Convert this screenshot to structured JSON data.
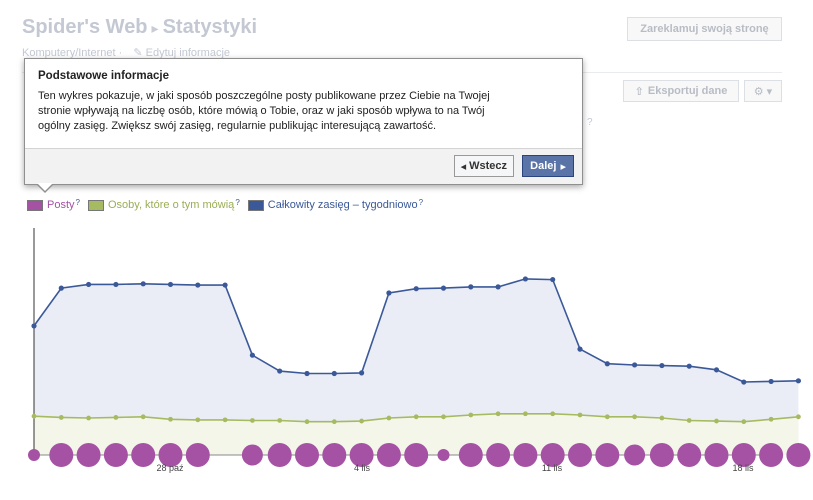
{
  "header": {
    "title": "Spider's Web",
    "title_sep": "▸",
    "section": "Statystyki",
    "category": "Komputery/Internet",
    "category_sep": "·",
    "edit_label": "Edytuj informacje",
    "promote_label": "Zareklamuj swoją stronę"
  },
  "toolbar": {
    "export_label": "Eksportuj dane",
    "faded_q": "?"
  },
  "popup": {
    "title": "Podstawowe informacje",
    "text_line1": "Ten wykres pokazuje, w jaki sposób poszczególne posty publikowane przez Ciebie na Twojej",
    "text_line2": "stronie wpływają na liczbę osób, które mówią o Tobie, oraz w jaki sposób wpływa to na Twój",
    "text_line3": "ogólny zasięg. Zwiększ swój zasięg, regularnie publikując interesującą zawartość.",
    "back_label": "Wstecz",
    "next_label": "Dalej"
  },
  "legend": [
    {
      "label": "Posty",
      "q": "?",
      "color": "#a552a4"
    },
    {
      "label": "Osoby, które o tym mówią",
      "q": "?",
      "color": "#a6bb61"
    },
    {
      "label": "Całkowity zasięg – tygodniowo",
      "q": "?",
      "color": "#3b5998"
    }
  ],
  "colors": {
    "reach_line": "#3b5998",
    "reach_fill": "#eaedf6",
    "talking_line": "#a6bb61",
    "talking_fill": "#f4f6ea",
    "posts": "#a552a4"
  },
  "chart_data": {
    "type": "line",
    "x_ticks": [
      "28 paź",
      "4 lis",
      "11 lis",
      "18 lis"
    ],
    "series": [
      {
        "name": "Całkowity zasięg – tygodniowo",
        "values": [
          64,
          95,
          98,
          98,
          98.5,
          98,
          97.5,
          97.5,
          40,
          27,
          25,
          25,
          25.5,
          91,
          94.5,
          95,
          96,
          96,
          102.5,
          102,
          45,
          33,
          32,
          31.5,
          31,
          28,
          18,
          18.5,
          19
        ]
      },
      {
        "name": "Posty",
        "values": [
          1,
          3,
          3,
          3,
          3,
          3,
          3,
          0,
          2,
          3,
          3,
          3,
          3,
          3,
          3,
          1,
          3,
          3,
          3,
          3,
          3,
          3,
          2,
          3,
          3,
          3,
          3,
          3,
          3
        ]
      },
      {
        "name": "Osoby, które o tym mówią",
        "values": [
          -10,
          -11,
          -11.5,
          -11,
          -10.5,
          -12.5,
          -13,
          -13,
          -13.5,
          -13.5,
          -14.5,
          -14.5,
          -14,
          -11.5,
          -10.5,
          -10.5,
          -9,
          -8,
          -8,
          -8,
          -9,
          -10.5,
          -10.5,
          -11.5,
          -13.5,
          -14,
          -14.5,
          -12.5,
          -10.5
        ]
      }
    ]
  }
}
